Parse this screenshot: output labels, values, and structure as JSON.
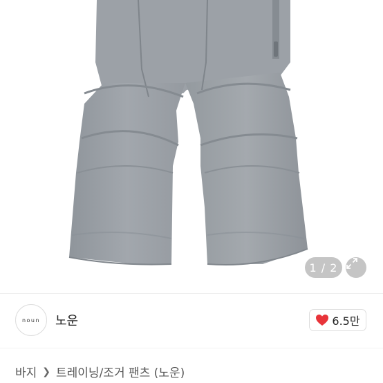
{
  "gallery": {
    "counter": "1 / 2",
    "current": 1,
    "total": 2,
    "expand_icon": "expand-icon",
    "product_color": "#9aa0a6"
  },
  "store": {
    "logo_text": "noun",
    "name": "노운",
    "like_icon": "heart-icon",
    "like_color": "#e8343a",
    "like_count": "6.5만"
  },
  "breadcrumb": {
    "items": [
      "바지",
      "트레이닝/조거 팬츠 (노운)"
    ]
  }
}
